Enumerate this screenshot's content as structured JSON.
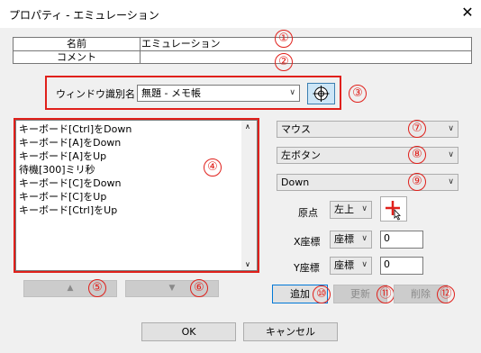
{
  "window": {
    "title": "プロパティ - エミュレーション"
  },
  "props": {
    "name_label": "名前",
    "name_value": "エミュレーション",
    "comment_label": "コメント",
    "comment_value": ""
  },
  "window_id": {
    "label": "ウィンドウ識別名",
    "value": "無題 - メモ帳"
  },
  "actions": [
    "キーボード[Ctrl]をDown",
    "キーボード[A]をDown",
    "キーボード[A]をUp",
    "待機[300]ミリ秒",
    "キーボード[C]をDown",
    "キーボード[C]をUp",
    "キーボード[Ctrl]をUp"
  ],
  "right": {
    "device": "マウス",
    "button": "左ボタン",
    "action": "Down",
    "origin_label": "原点",
    "origin_value": "左上",
    "x_label": "X座標",
    "x_mode": "座標",
    "x_value": "0",
    "y_label": "Y座標",
    "y_mode": "座標",
    "y_value": "0"
  },
  "buttons": {
    "add": "追加",
    "update": "更新",
    "delete": "削除",
    "up": "▲",
    "down": "▼",
    "ok": "OK",
    "cancel": "キャンセル"
  },
  "markers": [
    "①",
    "②",
    "③",
    "④",
    "⑤",
    "⑥",
    "⑦",
    "⑧",
    "⑨",
    "⑩",
    "⑪",
    "⑫"
  ],
  "colors": {
    "accent": "#e0201b",
    "window_bg": "#f0f0f0",
    "crosshair_button": "#cde6f7"
  }
}
